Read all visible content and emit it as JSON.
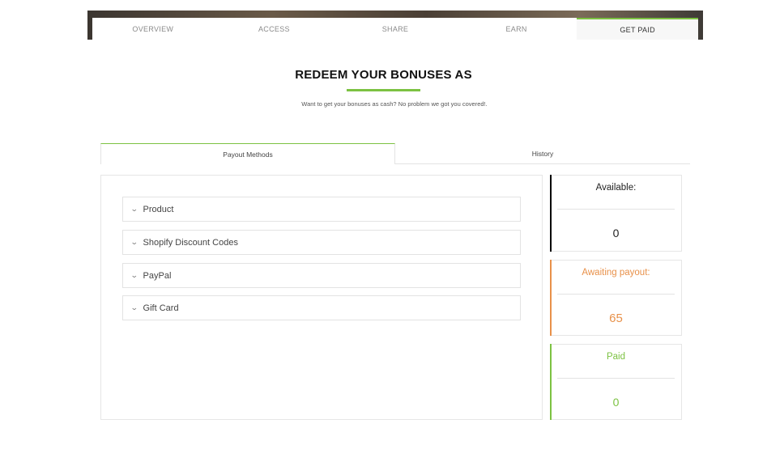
{
  "nav": {
    "tabs": [
      "OVERVIEW",
      "ACCESS",
      "SHARE",
      "EARN",
      "GET PAID"
    ],
    "active": "GET PAID"
  },
  "header": {
    "title": "REDEEM YOUR BONUSES AS",
    "subtitle": "Want to get your bonuses as cash? No problem we got you covered!."
  },
  "tabs": {
    "payout_methods": "Payout Methods",
    "history": "History"
  },
  "methods": [
    "Product",
    "Shopify Discount Codes",
    "PayPal",
    "Gift Card"
  ],
  "stats": {
    "available": {
      "label": "Available:",
      "value": "0",
      "color": "#000000"
    },
    "awaiting": {
      "label": "Awaiting payout:",
      "value": "65",
      "color": "#e8914a"
    },
    "paid": {
      "label": "Paid",
      "value": "0",
      "color": "#7cc242"
    }
  },
  "colors": {
    "accent": "#7cc242"
  }
}
